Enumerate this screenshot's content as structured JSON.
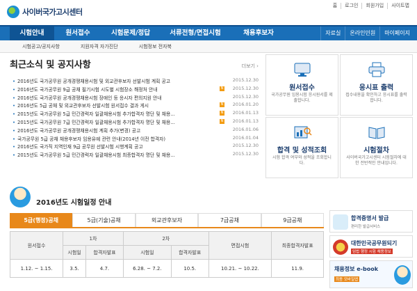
{
  "header": {
    "logo_text": "사이버국가고시센터",
    "util_links": [
      "홈",
      "로그인",
      "회원가입",
      "사이트맵"
    ]
  },
  "gnb": {
    "items": [
      {
        "label": "시험안내",
        "active": true
      },
      {
        "label": "원서접수",
        "active": false
      },
      {
        "label": "시험문제/정답",
        "active": false
      },
      {
        "label": "서류전형/면접시험",
        "active": false
      },
      {
        "label": "채용후보자",
        "active": false
      }
    ],
    "right_links": [
      "자료실",
      "온라인민원",
      "마이페이지"
    ]
  },
  "subnav": [
    "시험공고/공지사항",
    "지원자격 자가진단",
    "시험정보 전자북"
  ],
  "news": {
    "title": "최근소식 및 공지사항",
    "more_label": "더보기 ›",
    "items": [
      {
        "title": "2016년도 국가공무원 공개경쟁채용시험 및 외교관후보자 선발시험 계획 공고",
        "date": "2015.12.30",
        "new": false
      },
      {
        "title": "2016년도 국가공무원 9급 공채 필기시험 시도별 시험장소 해정처 안내",
        "date": "2015.12.30",
        "new": true
      },
      {
        "title": "2016년도 국가공무원 공개경쟁채용시험 장애인 등 응시자 편의지원 안내",
        "date": "2015.12.30",
        "new": false
      },
      {
        "title": "2016년도 5급 공채 및 외교관후보자 선발시험 원서접수 결과 게시",
        "date": "2016.01.20",
        "new": true
      },
      {
        "title": "2015년도 국가공무원 5급 민간경력자 일괄채용시험 추가합격자 명단 및 채용...",
        "date": "2016.01.13",
        "new": true
      },
      {
        "title": "2015년도 국가공무원 7급 민간경력자 일괄채용시험 추가합격자 명단 및 채용...",
        "date": "2016.01.13",
        "new": true
      },
      {
        "title": "2016년도 국가공무원 공개경쟁채용시험 계획 추가(변경) 공고",
        "date": "2016.01.06",
        "new": false
      },
      {
        "title": "국가공무원 5급 공채 채용후보자 임용유예 관련 안내(2014년 이전 합격자)",
        "date": "2016.01.04",
        "new": false
      },
      {
        "title": "2016년도 국가직 지역인재 9급 공무원 선발시험 시행계획 공고",
        "date": "2015.12.30",
        "new": false
      },
      {
        "title": "2015년도 국가공무원 5급 민간경력자 일괄채용시험 최종합격자 명단 및 채용...",
        "date": "2015.12.30",
        "new": false
      }
    ]
  },
  "tiles": [
    {
      "label": "원서접수",
      "desc": "국가공무원 임용시험 응시원서를 제출합니다.",
      "icon": "monitor-icon"
    },
    {
      "label": "응시표 출력",
      "desc": "접수내용을 확인하고 응시표를 출력합니다.",
      "icon": "printer-icon"
    },
    {
      "label": "합격 및 성적조회",
      "desc": "시험 합격 여부와 성적을 조회합니다.",
      "icon": "search-chart-icon"
    },
    {
      "label": "시험절차",
      "desc": "사이버국가고시센터 시험절차에 대한 전반적인 안내입니다.",
      "icon": "book-icon"
    }
  ],
  "schedule": {
    "title": "2016년도 시험일정 안내",
    "tabs": [
      {
        "label": "5급(행정)공채",
        "active": true
      },
      {
        "label": "5급(기술)공채",
        "active": false
      },
      {
        "label": "외교관후보자",
        "active": false
      },
      {
        "label": "7급공채",
        "active": false
      },
      {
        "label": "9급공채",
        "active": false
      }
    ],
    "headers": {
      "application": "원서접수",
      "round1": "1차",
      "round2": "2차",
      "exam_date": "시험일",
      "pass_announce": "합격자발표",
      "interview": "면접시험",
      "final": "최종합격자발표"
    },
    "values": [
      "1.12. ~ 1.15.",
      "3.5.",
      "4.7.",
      "6.28. ~ 7.2.",
      "10.5.",
      "10.21. ~ 10.22.",
      "11.9."
    ]
  },
  "banners": [
    {
      "title": "합격증명서 발급",
      "sub": "편리한 발급서비스"
    },
    {
      "title": "대한민국공무원되기",
      "sub": "임법 행정 시험 채용정보"
    },
    {
      "title": "채용정보 e-book",
      "sub": "최종 모바일앱"
    }
  ]
}
